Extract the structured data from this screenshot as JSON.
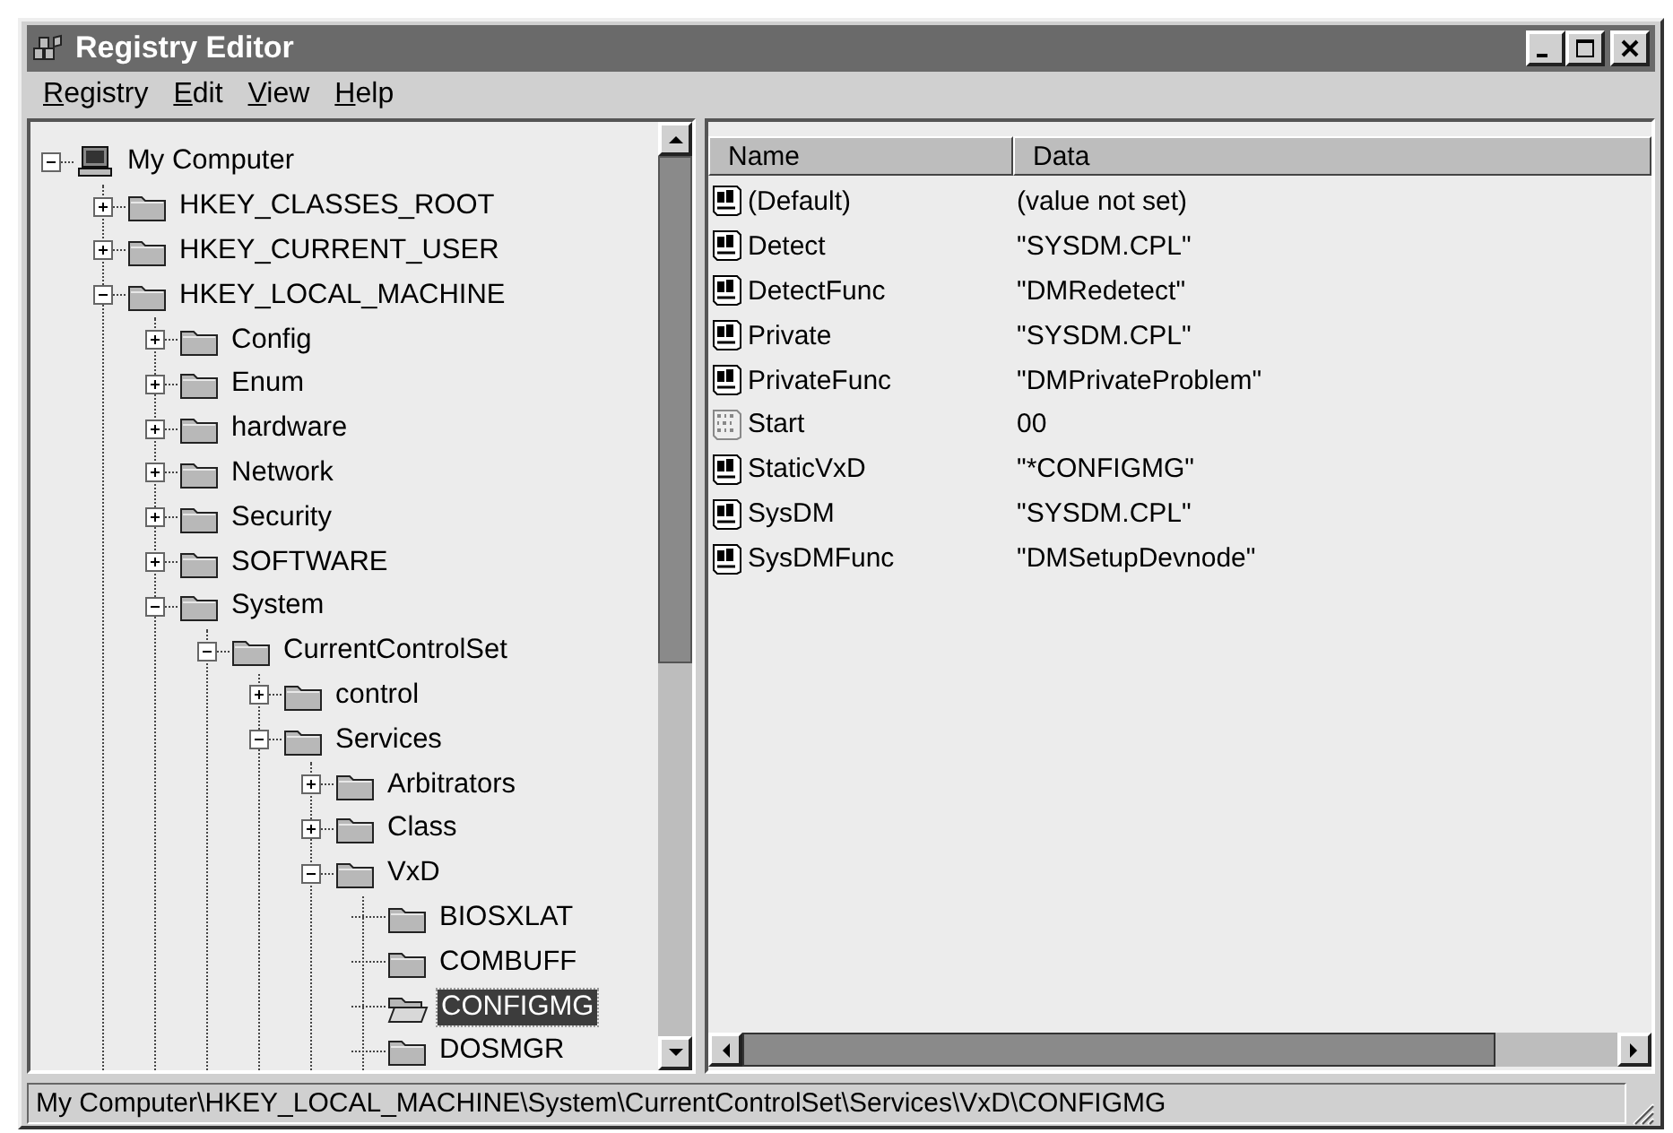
{
  "window": {
    "title": "Registry Editor"
  },
  "menu": [
    "Registry",
    "Edit",
    "View",
    "Help"
  ],
  "tree": [
    {
      "label": "My Computer",
      "kind": "computer",
      "expanded": true,
      "selected": false,
      "children": [
        {
          "label": "HKEY_CLASSES_ROOT",
          "kind": "branch",
          "expanded": false,
          "selected": false
        },
        {
          "label": "HKEY_CURRENT_USER",
          "kind": "branch",
          "expanded": false,
          "selected": false
        },
        {
          "label": "HKEY_LOCAL_MACHINE",
          "kind": "branch",
          "expanded": true,
          "selected": false,
          "children": [
            {
              "label": "Config",
              "kind": "branch",
              "expanded": false,
              "selected": false
            },
            {
              "label": "Enum",
              "kind": "branch",
              "expanded": false,
              "selected": false
            },
            {
              "label": "hardware",
              "kind": "branch",
              "expanded": false,
              "selected": false
            },
            {
              "label": "Network",
              "kind": "branch",
              "expanded": false,
              "selected": false
            },
            {
              "label": "Security",
              "kind": "branch",
              "expanded": false,
              "selected": false
            },
            {
              "label": "SOFTWARE",
              "kind": "branch",
              "expanded": false,
              "selected": false
            },
            {
              "label": "System",
              "kind": "branch",
              "expanded": true,
              "selected": false,
              "children": [
                {
                  "label": "CurrentControlSet",
                  "kind": "branch",
                  "expanded": true,
                  "selected": false,
                  "children": [
                    {
                      "label": "control",
                      "kind": "branch",
                      "expanded": false,
                      "selected": false
                    },
                    {
                      "label": "Services",
                      "kind": "branch",
                      "expanded": true,
                      "selected": false,
                      "children": [
                        {
                          "label": "Arbitrators",
                          "kind": "branch",
                          "expanded": false,
                          "selected": false
                        },
                        {
                          "label": "Class",
                          "kind": "branch",
                          "expanded": false,
                          "selected": false
                        },
                        {
                          "label": "VxD",
                          "kind": "branch",
                          "expanded": true,
                          "selected": false,
                          "children": [
                            {
                              "label": "BIOSXLAT",
                              "kind": "leaf",
                              "selected": false
                            },
                            {
                              "label": "COMBUFF",
                              "kind": "leaf",
                              "selected": false
                            },
                            {
                              "label": "CONFIGMG",
                              "kind": "leaf",
                              "selected": true
                            },
                            {
                              "label": "DOSMGR",
                              "kind": "leaf",
                              "selected": false
                            }
                          ]
                        }
                      ]
                    }
                  ]
                }
              ]
            }
          ]
        }
      ]
    }
  ],
  "values": {
    "columns": [
      "Name",
      "Data"
    ],
    "rows": [
      {
        "kind": "string",
        "name": "(Default)",
        "data": "(value not set)"
      },
      {
        "kind": "string",
        "name": "Detect",
        "data": "\"SYSDM.CPL\""
      },
      {
        "kind": "string",
        "name": "DetectFunc",
        "data": "\"DMRedetect\""
      },
      {
        "kind": "string",
        "name": "Private",
        "data": "\"SYSDM.CPL\""
      },
      {
        "kind": "string",
        "name": "PrivateFunc",
        "data": "\"DMPrivateProblem\""
      },
      {
        "kind": "binary",
        "name": "Start",
        "data": "00"
      },
      {
        "kind": "string",
        "name": "StaticVxD",
        "data": "\"*CONFIGMG\""
      },
      {
        "kind": "string",
        "name": "SysDM",
        "data": "\"SYSDM.CPL\""
      },
      {
        "kind": "string",
        "name": "SysDMFunc",
        "data": "\"DMSetupDevnode\""
      }
    ]
  },
  "status_bar": "My Computer\\HKEY_LOCAL_MACHINE\\System\\CurrentControlSet\\Services\\VxD\\CONFIGMG"
}
